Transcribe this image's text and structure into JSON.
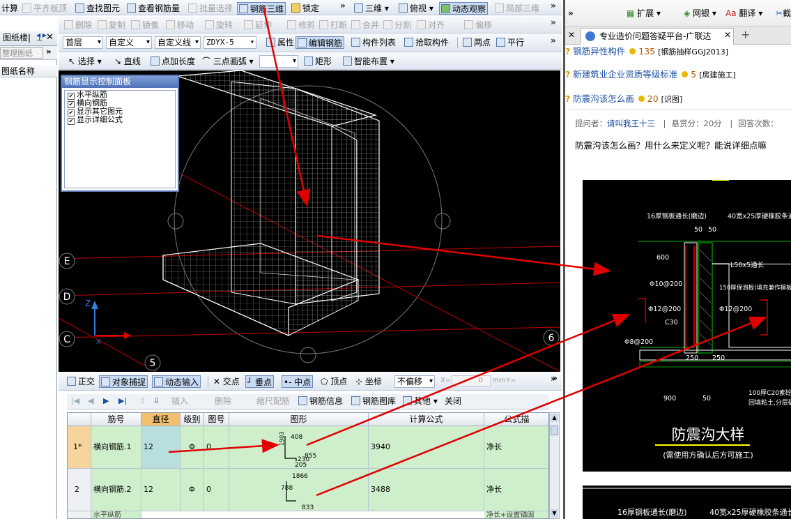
{
  "toolbar1": {
    "items": [
      {
        "label": "计算",
        "dis": false
      },
      {
        "label": "平齐板顶",
        "dis": true
      },
      {
        "label": "查找图元",
        "dis": false
      },
      {
        "label": "查看钢筋量",
        "dis": false
      },
      {
        "label": "批量选择",
        "dis": true
      },
      {
        "label": "钢筋三维",
        "dis": false,
        "pressed": true
      },
      {
        "label": "锁定",
        "dis": false
      },
      {
        "label": "三维",
        "dis": false
      },
      {
        "label": "俯视",
        "dis": false
      },
      {
        "label": "动态观察",
        "dis": false,
        "pressed": true
      },
      {
        "label": "局部三维",
        "dis": true
      }
    ]
  },
  "toolbar2": {
    "items": [
      "删除",
      "复制",
      "镜像",
      "移动",
      "旋转",
      "延伸",
      "修剪",
      "打断",
      "合并",
      "分割",
      "对齐",
      "偏移"
    ]
  },
  "toolbar3": {
    "floor": "首层",
    "type": "自定义",
    "cat": "自定义线",
    "name": "ZDYX-5",
    "buttons": [
      "属性",
      "编辑钢筋",
      "构件列表",
      "拾取构件",
      "两点",
      "平行"
    ]
  },
  "toolbar4": {
    "items": [
      "选择",
      "直线",
      "点加长度",
      "三点画弧",
      "矩形",
      "智能布置"
    ]
  },
  "left": {
    "tab": "图纸楼|",
    "sub": "整理图纸",
    "col": "图纸名称"
  },
  "panel": {
    "title": "钢筋显示控制面板",
    "options": [
      "水平纵筋",
      "横向钢筋",
      "显示其它图元",
      "显示详细公式"
    ]
  },
  "axes": {
    "labels": [
      "E",
      "D",
      "C",
      "5",
      "6"
    ],
    "z": "Z",
    "x": "X"
  },
  "snapbar": {
    "items": [
      "正交",
      "对象捕捉",
      "动态输入",
      "交点",
      "垂点",
      "中点",
      "顶点",
      "坐标"
    ],
    "offset": "不偏移",
    "x": "X=",
    "xval": "0",
    "unit": "mm",
    "y": "Y="
  },
  "navbar": {
    "items": [
      "插入",
      "删除",
      "缩尺配筋",
      "钢筋信息",
      "钢筋图库",
      "其他",
      "关闭"
    ]
  },
  "table": {
    "headers": [
      "筋号",
      "直径(mm)",
      "级别",
      "图号",
      "图形",
      "计算公式",
      "公式描"
    ],
    "rows": [
      {
        "no": "1*",
        "name": "横向钢筋.1",
        "dia": "12",
        "grade": "Φ",
        "fig": "0",
        "formula": "3940",
        "desc": "净长",
        "s1": "408",
        "s2": "855",
        "s3": "230",
        "s4": "205",
        "s5": "1903"
      },
      {
        "no": "2",
        "name": "横向钢筋.2",
        "dia": "12",
        "grade": "Φ",
        "fig": "0",
        "formula": "3488",
        "desc": "净长",
        "s1": "1866",
        "s2": "788",
        "s3": "833"
      }
    ],
    "row3": "水平纵筋",
    "row3desc": "净长+设置锚固"
  },
  "browser": {
    "toolbar": [
      "扩展",
      "网银",
      "翻译",
      "截"
    ],
    "tab": "专业造价问题答疑平台-广联达",
    "questions": [
      {
        "title": "钢筋异性构件",
        "coins": "135",
        "tag": "[钢筋抽样GGJ2013]"
      },
      {
        "title": "新建筑业企业资质等级标准",
        "coins": "5",
        "tag": "[房建施工]"
      },
      {
        "title": "防震沟该怎么画",
        "coins": "20",
        "tag": "[识图]"
      }
    ],
    "asker_label": "提问者：",
    "asker": "请叫我王十三",
    "reward": "悬赏分：20分",
    "answers": "回答次数：",
    "question": "防震沟该怎么画？用什么来定义呢？能说详细点嘛"
  },
  "cad": {
    "title": "防震沟大样",
    "subtitle": "(需使用方确认后方可施工)",
    "labels": [
      "16厚钢板通长(磨边)",
      "40宽x25厚硬橡胶条通长",
      "50",
      "50",
      "600",
      "L50x5通长",
      "Φ10@200",
      "150厚保泡板(填充兼作模板)",
      "Φ12@200",
      "Φ12@200",
      "C30",
      "Φ8@200",
      "250",
      "250",
      "900",
      "50",
      "100厚C20素砼垫层",
      "回填粘土,分层碾实"
    ],
    "bottom": [
      "16厚钢板通长(磨边)",
      "40宽x25厚硬橡胶条通长"
    ]
  },
  "colors": {
    "arrow": "#e00000",
    "accent": "#1a4fa0"
  }
}
